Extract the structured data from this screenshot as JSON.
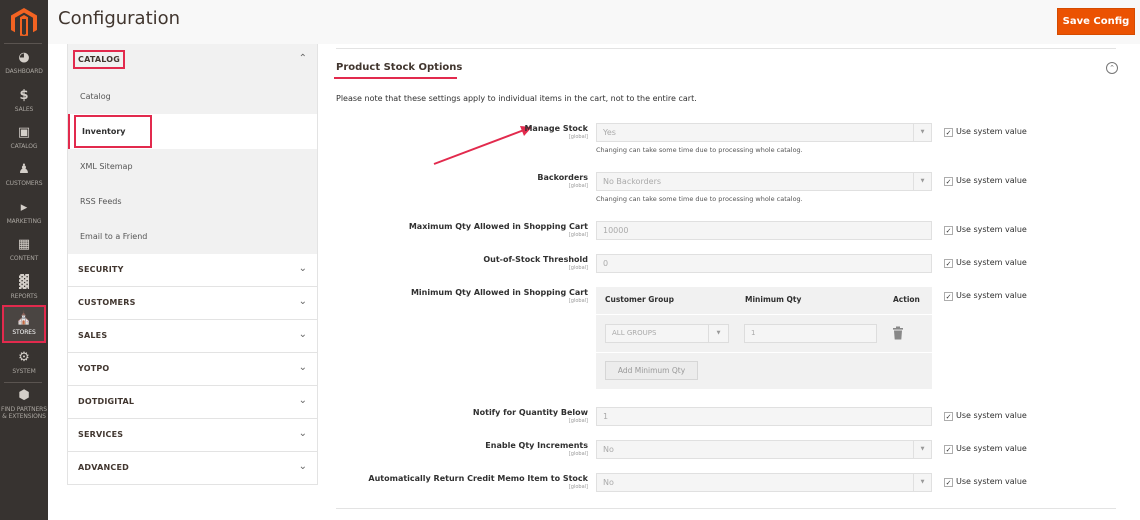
{
  "admin_nav": {
    "items": [
      {
        "label": "Dashboard",
        "icon": "dashboard-icon"
      },
      {
        "label": "Sales",
        "icon": "dollar-icon"
      },
      {
        "label": "Catalog",
        "icon": "box-icon"
      },
      {
        "label": "Customers",
        "icon": "person-icon"
      },
      {
        "label": "Marketing",
        "icon": "megaphone-icon"
      },
      {
        "label": "Content",
        "icon": "layout-icon"
      },
      {
        "label": "Reports",
        "icon": "bar-chart-icon"
      },
      {
        "label": "Stores",
        "icon": "storefront-icon",
        "active": true
      },
      {
        "label": "System",
        "icon": "gear-icon"
      },
      {
        "label": "Find Partners & Extensions",
        "icon": "cube-icon"
      }
    ]
  },
  "header": {
    "title": "Configuration",
    "save_label": "Save Config",
    "accent": "#eb5202"
  },
  "config_nav": {
    "open_tab": {
      "title": "CATALOG",
      "items": [
        "Catalog",
        "Inventory",
        "XML Sitemap",
        "RSS Feeds",
        "Email to a Friend"
      ],
      "active_item": "Inventory"
    },
    "tabs": [
      "SECURITY",
      "CUSTOMERS",
      "SALES",
      "YOTPO",
      "DOTDIGITAL",
      "SERVICES",
      "ADVANCED"
    ]
  },
  "section": {
    "title": "Product Stock Options",
    "note": "Please note that these settings apply to individual items in the cart, not to the entire cart.",
    "use_system_label": "Use system value",
    "scope": "[global]",
    "fields": [
      {
        "label": "Manage Stock",
        "value": "Yes",
        "type": "select",
        "hint": "Changing can take some time due to processing whole catalog.",
        "use_system": true
      },
      {
        "label": "Backorders",
        "value": "No Backorders",
        "type": "select",
        "hint": "Changing can take some time due to processing whole catalog.",
        "use_system": true
      },
      {
        "label": "Maximum Qty Allowed in Shopping Cart",
        "value": "10000",
        "type": "input",
        "use_system": true
      },
      {
        "label": "Out-of-Stock Threshold",
        "value": "0",
        "type": "input",
        "use_system": true
      },
      {
        "label": "Minimum Qty Allowed in Shopping Cart",
        "type": "table",
        "use_system": true
      },
      {
        "label": "Notify for Quantity Below",
        "value": "1",
        "type": "input",
        "use_system": true
      },
      {
        "label": "Enable Qty Increments",
        "value": "No",
        "type": "select",
        "use_system": true
      },
      {
        "label": "Automatically Return Credit Memo Item to Stock",
        "value": "No",
        "type": "select",
        "use_system": true
      }
    ],
    "min_qty_table": {
      "headers": [
        "Customer Group",
        "Minimum Qty",
        "Action"
      ],
      "rows": [
        {
          "group": "ALL GROUPS",
          "qty": "1"
        }
      ],
      "add_label": "Add Minimum Qty"
    }
  },
  "highlight_color": "#e22a4d"
}
